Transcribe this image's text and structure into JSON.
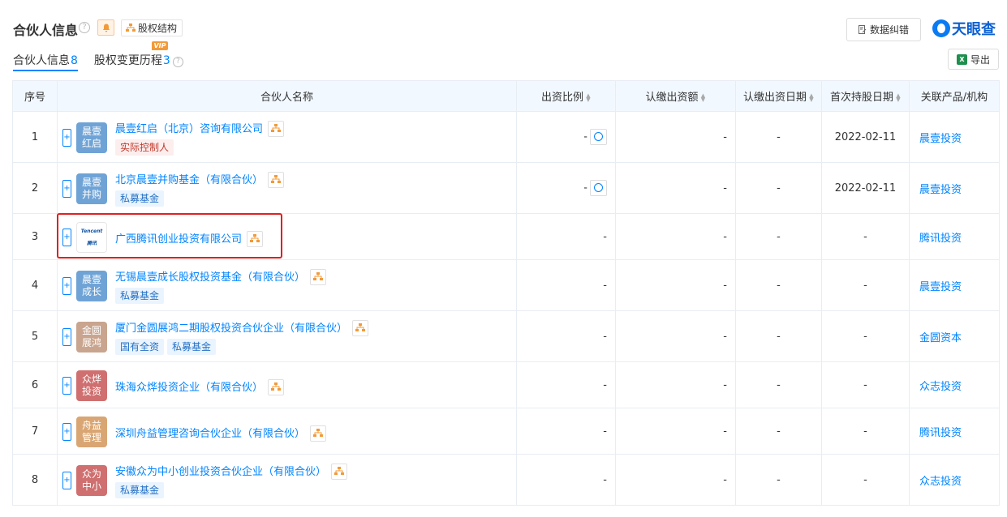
{
  "header": {
    "title": "合伙人信息",
    "equity_button": "股权结构",
    "fix_button": "数据纠错",
    "logo": "天眼查",
    "export_button": "导出",
    "vip_badge": "VIP"
  },
  "tabs": [
    {
      "label": "合伙人信息",
      "count": "8"
    },
    {
      "label": "股权变更历程",
      "count": "3"
    }
  ],
  "columns": [
    "序号",
    "合伙人名称",
    "出资比例",
    "认缴出资额",
    "认缴出资日期",
    "首次持股日期",
    "关联产品/机构"
  ],
  "rows": [
    {
      "no": "1",
      "avatar": "晨壹红启",
      "avatar_color": "#6fa3d6",
      "name": "晨壹红启（北京）咨询有限公司",
      "tags": [
        {
          "text": "实际控制人",
          "kind": "red"
        }
      ],
      "ratio": "-",
      "amount": "-",
      "date": "-",
      "first_date": "2022-02-11",
      "product": "晨壹投资"
    },
    {
      "no": "2",
      "avatar": "晨壹并购",
      "avatar_color": "#6fa3d6",
      "name": "北京晨壹并购基金（有限合伙）",
      "tags": [
        {
          "text": "私募基金",
          "kind": "blue"
        }
      ],
      "ratio": "-",
      "amount": "-",
      "date": "-",
      "first_date": "2022-02-11",
      "product": "晨壹投资"
    },
    {
      "no": "3",
      "avatar": "Tencent腾讯",
      "avatar_color": "#ffffff",
      "name": "广西腾讯创业投资有限公司",
      "tags": [],
      "ratio": "-",
      "amount": "-",
      "date": "-",
      "first_date": "-",
      "product": "腾讯投资"
    },
    {
      "no": "4",
      "avatar": "晨壹成长",
      "avatar_color": "#6fa3d6",
      "name": "无锡晨壹成长股权投资基金（有限合伙）",
      "tags": [
        {
          "text": "私募基金",
          "kind": "blue"
        }
      ],
      "ratio": "-",
      "amount": "-",
      "date": "-",
      "first_date": "-",
      "product": "晨壹投资"
    },
    {
      "no": "5",
      "avatar": "金圆展鸿",
      "avatar_color": "#c9a48e",
      "name": "厦门金圆展鸿二期股权投资合伙企业（有限合伙）",
      "tags": [
        {
          "text": "国有全资",
          "kind": "blue"
        },
        {
          "text": "私募基金",
          "kind": "blue"
        }
      ],
      "ratio": "-",
      "amount": "-",
      "date": "-",
      "first_date": "-",
      "product": "金圆资本"
    },
    {
      "no": "6",
      "avatar": "众烨投资",
      "avatar_color": "#cf6f6f",
      "name": "珠海众烨投资企业（有限合伙）",
      "tags": [],
      "ratio": "-",
      "amount": "-",
      "date": "-",
      "first_date": "-",
      "product": "众志投资"
    },
    {
      "no": "7",
      "avatar": "舟益管理",
      "avatar_color": "#d9a673",
      "name": "深圳舟益管理咨询合伙企业（有限合伙）",
      "tags": [],
      "ratio": "-",
      "amount": "-",
      "date": "-",
      "first_date": "-",
      "product": "腾讯投资"
    },
    {
      "no": "8",
      "avatar": "众为中小",
      "avatar_color": "#cf6f6f",
      "name": "安徽众为中小创业投资合伙企业（有限合伙）",
      "tags": [
        {
          "text": "私募基金",
          "kind": "blue"
        }
      ],
      "ratio": "-",
      "amount": "-",
      "date": "-",
      "first_date": "-",
      "product": "众志投资"
    }
  ]
}
